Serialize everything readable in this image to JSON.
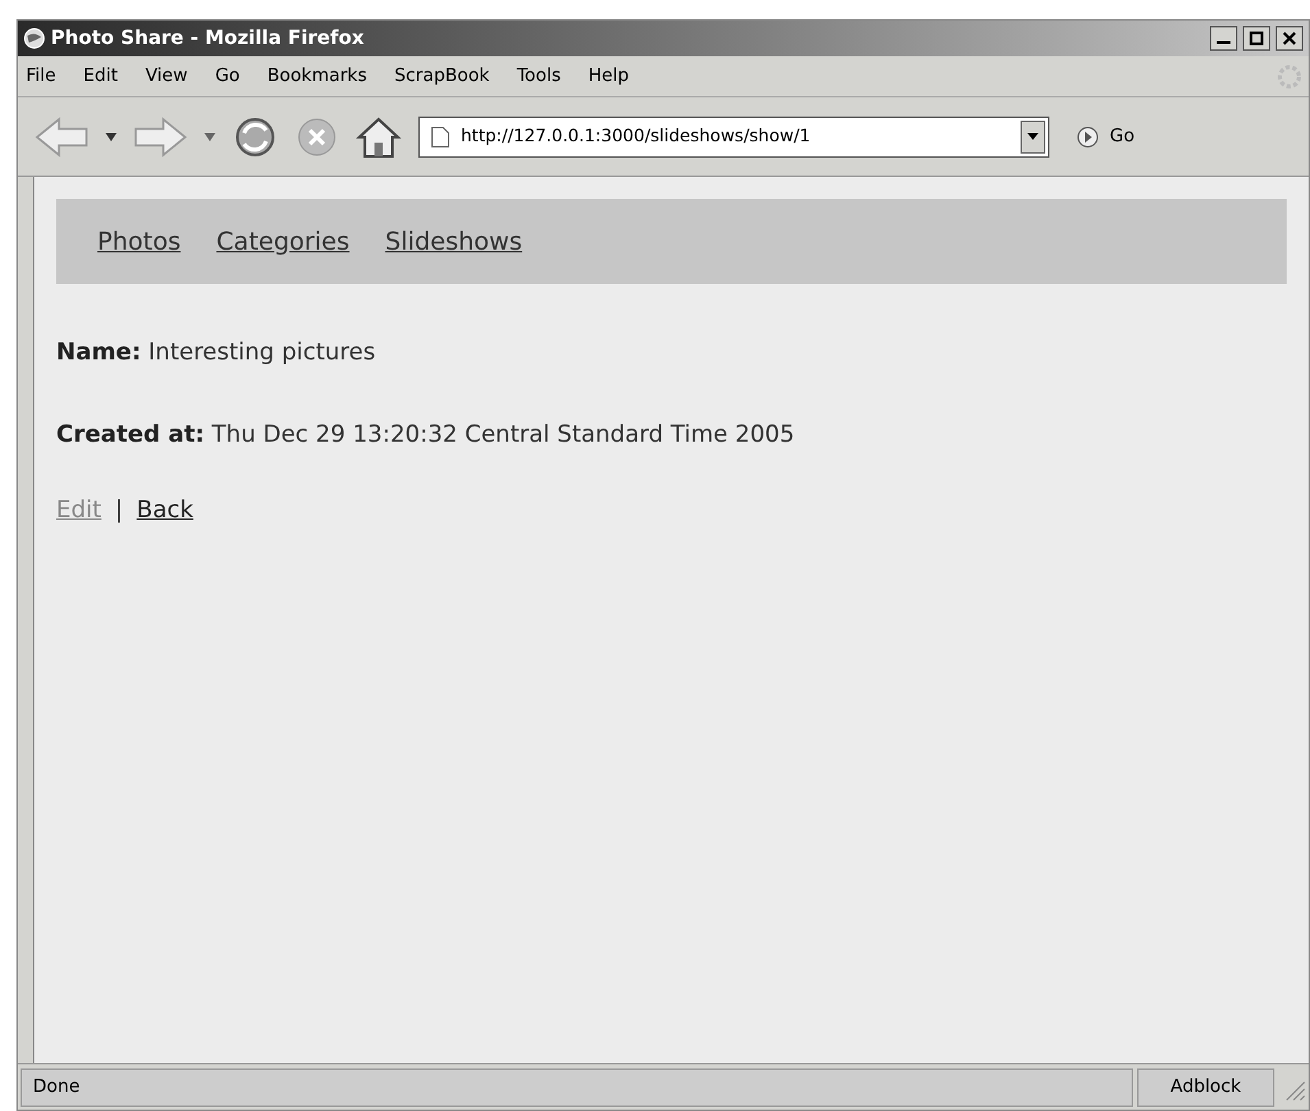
{
  "window": {
    "title": "Photo Share - Mozilla Firefox"
  },
  "menu": [
    "File",
    "Edit",
    "View",
    "Go",
    "Bookmarks",
    "ScrapBook",
    "Tools",
    "Help"
  ],
  "address_bar": {
    "value": "http://127.0.0.1:3000/slideshows/show/1",
    "go_label": "Go"
  },
  "nav_links": [
    "Photos",
    "Categories",
    "Slideshows"
  ],
  "fields": [
    {
      "label": "Name:",
      "value": "Interesting pictures"
    },
    {
      "label": "Created at:",
      "value": "Thu Dec 29 13:20:32 Central Standard Time 2005"
    }
  ],
  "actions": [
    {
      "label": "Edit",
      "visited": true
    },
    {
      "label": "Back",
      "visited": false
    }
  ],
  "separator": "|",
  "status_bar": {
    "text": "Done",
    "panel": "Adblock"
  }
}
